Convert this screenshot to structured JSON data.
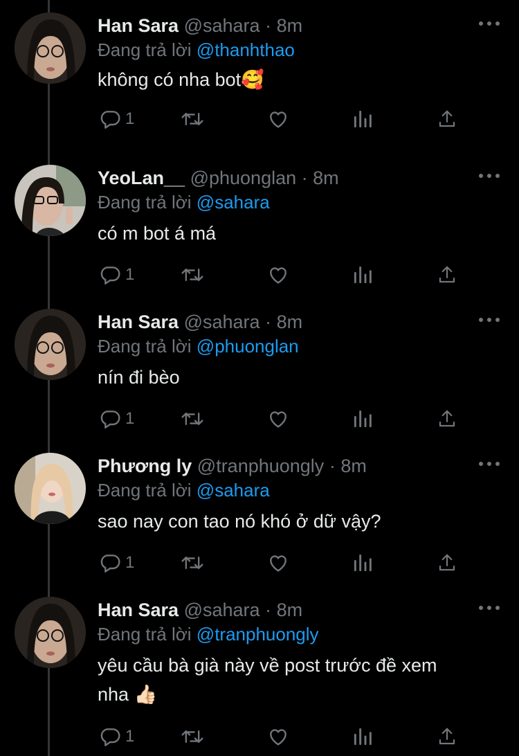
{
  "ui": {
    "reply_prefix": "Đang trả lời",
    "dot": "·",
    "icons": [
      "more-icon",
      "reply-icon",
      "retweet-icon",
      "like-icon",
      "views-icon",
      "share-icon"
    ],
    "colors": {
      "background": "#000000",
      "text": "#e7e9ea",
      "muted": "#71767b",
      "mention": "#1d9bf0",
      "thread_line": "#333639"
    }
  },
  "tweets": [
    {
      "name": "Han Sara",
      "handle": "@sahara",
      "time": "8m",
      "reply_to": "@thanhthao",
      "text_lines": [
        "không có nha bot🥰"
      ],
      "reply_count": "1"
    },
    {
      "name": "YeoLan__",
      "handle": "@phuonglan",
      "time": "8m",
      "reply_to": "@sahara",
      "text_lines": [
        "có m bot á má"
      ],
      "reply_count": "1"
    },
    {
      "name": "Han Sara",
      "handle": "@sahara",
      "time": "8m",
      "reply_to": "@phuonglan",
      "text_lines": [
        "nín đi bèo"
      ],
      "reply_count": "1"
    },
    {
      "name": "Phương ly",
      "handle": "@tranphuongly",
      "time": "8m",
      "reply_to": "@sahara",
      "text_lines": [
        "sao nay con tao nó khó ở dữ vậy?"
      ],
      "reply_count": "1"
    },
    {
      "name": "Han Sara",
      "handle": "@sahara",
      "time": "8m",
      "reply_to": "@tranphuongly",
      "text_lines": [
        "yêu cầu bà già này về post trước đề xem",
        "nha 👍🏻"
      ],
      "reply_count": "1"
    }
  ]
}
